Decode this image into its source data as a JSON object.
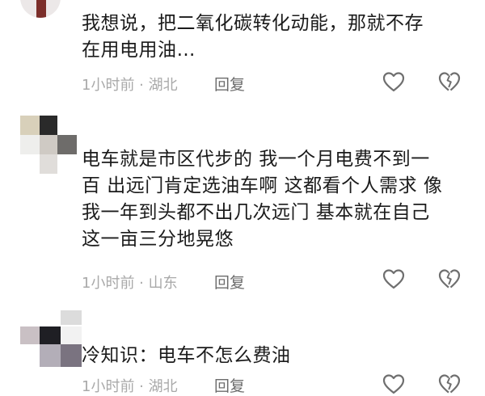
{
  "comments": [
    {
      "text": "我想说，把二氧化碳转化动能，那就不存\n在用电用油…",
      "meta": "1小时前 · 湖北",
      "reply_label": "回复"
    },
    {
      "text": "电车就是市区代步的 我一个月电费不到一\n百 出远门肯定选油车啊 这都看个人需求 像\n我一年到头都不出几次远门 基本就在自己\n这一亩三分地晃悠",
      "meta": "1小时前 · 山东",
      "reply_label": "回复"
    },
    {
      "text": "冷知识：电车不怎么费油",
      "meta": "1小时前 · 湖北",
      "reply_label": "回复"
    }
  ],
  "icons": {
    "like": "heart-outline-icon",
    "dislike": "broken-heart-icon"
  },
  "colors": {
    "text": "#1b1b1b",
    "meta": "#a9a9a9",
    "icon": "#6f6f6f"
  }
}
